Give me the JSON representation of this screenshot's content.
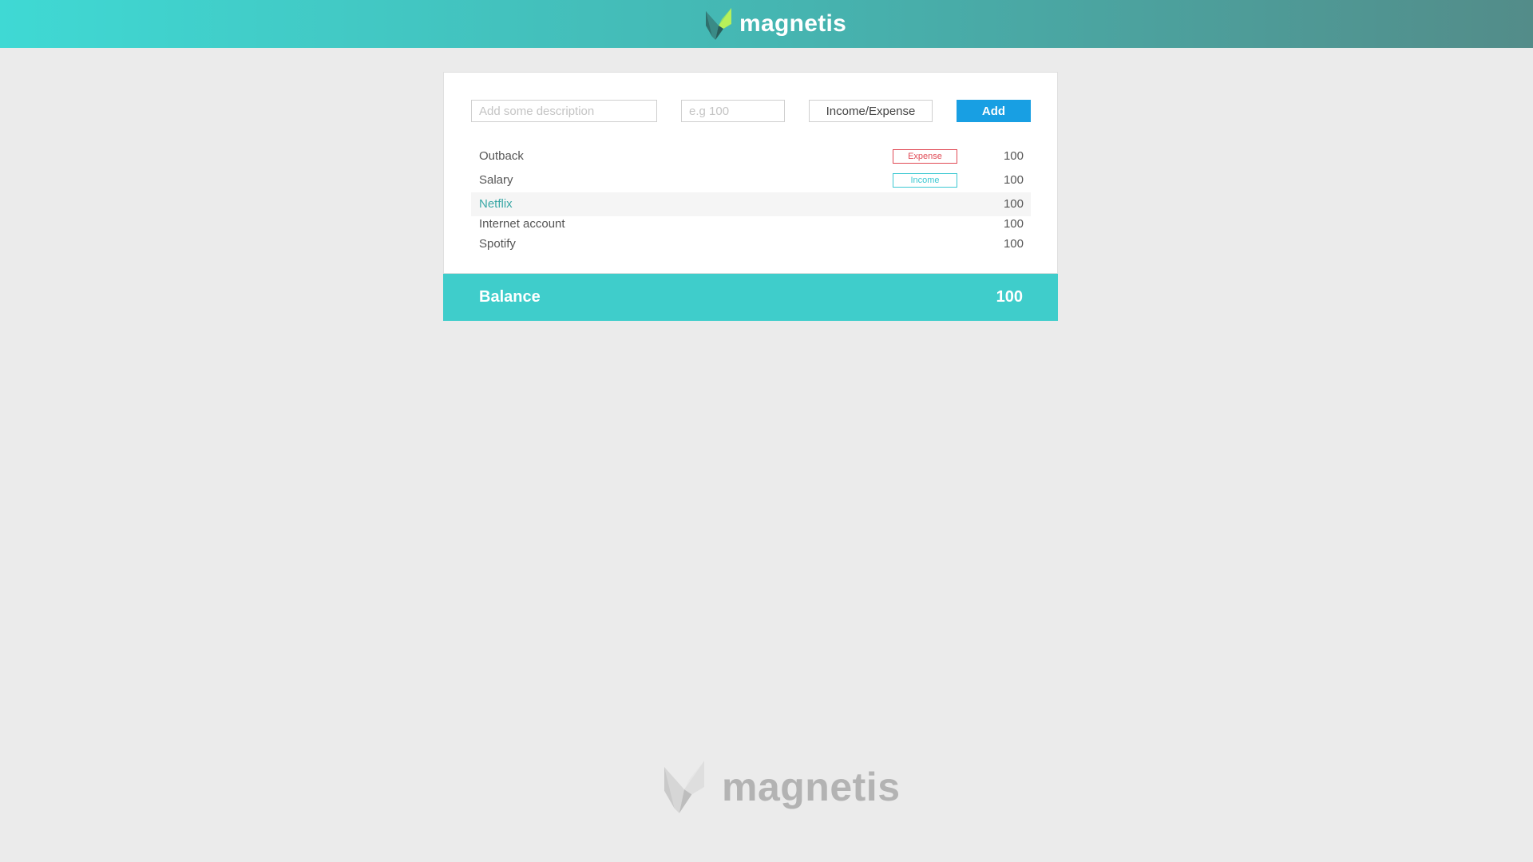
{
  "header": {
    "brand_name": "magnetis",
    "logo_icon": "magnetis-logo-icon",
    "gradient_colors": [
      "#3fd9d4",
      "#45b6b2",
      "#538c89"
    ]
  },
  "form": {
    "description_placeholder": "Add some description",
    "amount_placeholder": "e.g 100",
    "type_label": "Income/Expense",
    "add_label": "Add",
    "add_color": "#189fe3"
  },
  "transactions": [
    {
      "description": "Outback",
      "tag": "Expense",
      "amount": "100"
    },
    {
      "description": "Salary",
      "tag": "Income",
      "amount": "100"
    },
    {
      "description": "Netflix",
      "tag": "",
      "amount": "100"
    },
    {
      "description": "Internet account",
      "tag": "",
      "amount": "100"
    },
    {
      "description": "Spotify",
      "tag": "",
      "amount": "100"
    }
  ],
  "balance": {
    "label": "Balance",
    "value": "100",
    "color": "#3fcdcb"
  },
  "footer": {
    "brand_name": "magnetis",
    "logo_icon": "magnetis-logo-icon"
  },
  "colors": {
    "expense": "#e04a55",
    "income": "#3cc8d2",
    "highlight_text": "#3aa8a6",
    "background": "#ebebeb"
  }
}
